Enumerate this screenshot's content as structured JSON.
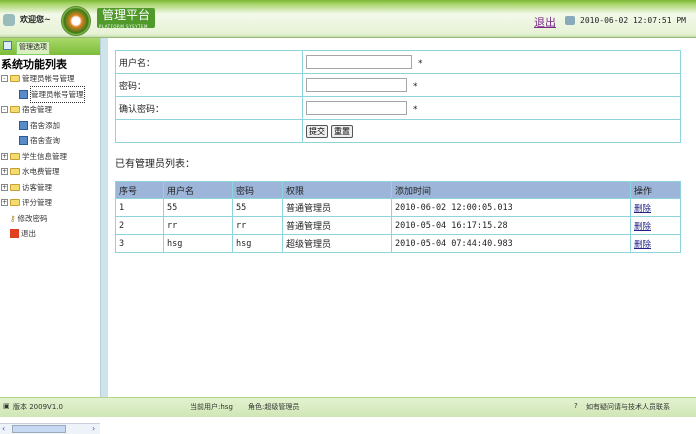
{
  "header": {
    "welcome": "欢迎您~",
    "logo_title": "管理平台",
    "logo_subtitle": "PLATFORM SYSYTEM",
    "logout": "退出",
    "datetime": "2010-06-02 12:07:51 PM"
  },
  "sidebar": {
    "header_label": "管理选项",
    "root": "系统功能列表",
    "items": [
      {
        "label": "管理员帐号管理",
        "type": "folder",
        "expanded": true
      },
      {
        "label": "管理员帐号管理",
        "type": "leaf",
        "selected": true
      },
      {
        "label": "宿舍管理",
        "type": "folder",
        "expanded": true
      },
      {
        "label": "宿舍添加",
        "type": "leaf"
      },
      {
        "label": "宿舍查询",
        "type": "leaf"
      },
      {
        "label": "学生信息管理",
        "type": "folder"
      },
      {
        "label": "水电费管理",
        "type": "folder"
      },
      {
        "label": "访客管理",
        "type": "folder"
      },
      {
        "label": "评分管理",
        "type": "folder"
      },
      {
        "label": "修改密码",
        "type": "key"
      },
      {
        "label": "退出",
        "type": "exit"
      }
    ]
  },
  "form": {
    "username_label": "用户名：",
    "password_label": "密码：",
    "confirm_label": "确认密码：",
    "required": "*",
    "submit": "提交",
    "reset": "重置"
  },
  "list": {
    "title": "已有管理员列表：",
    "columns": [
      "序号",
      "用户名",
      "密码",
      "权限",
      "添加时间",
      "操作"
    ],
    "rows": [
      [
        "1",
        "55",
        "55",
        "普通管理员",
        "2010-06-02 12:00:05.013",
        "删除"
      ],
      [
        "2",
        "rr",
        "rr",
        "普通管理员",
        "2010-05-04 16:17:15.28",
        "删除"
      ],
      [
        "3",
        "hsg",
        "hsg",
        "超级管理员",
        "2010-05-04 07:44:40.983",
        "删除"
      ]
    ]
  },
  "footer": {
    "version": "版本 2009V1.0",
    "current_user": "当前用户:hsg",
    "role": "角色:超级管理员",
    "help": "如有疑问请与技术人员联系"
  }
}
